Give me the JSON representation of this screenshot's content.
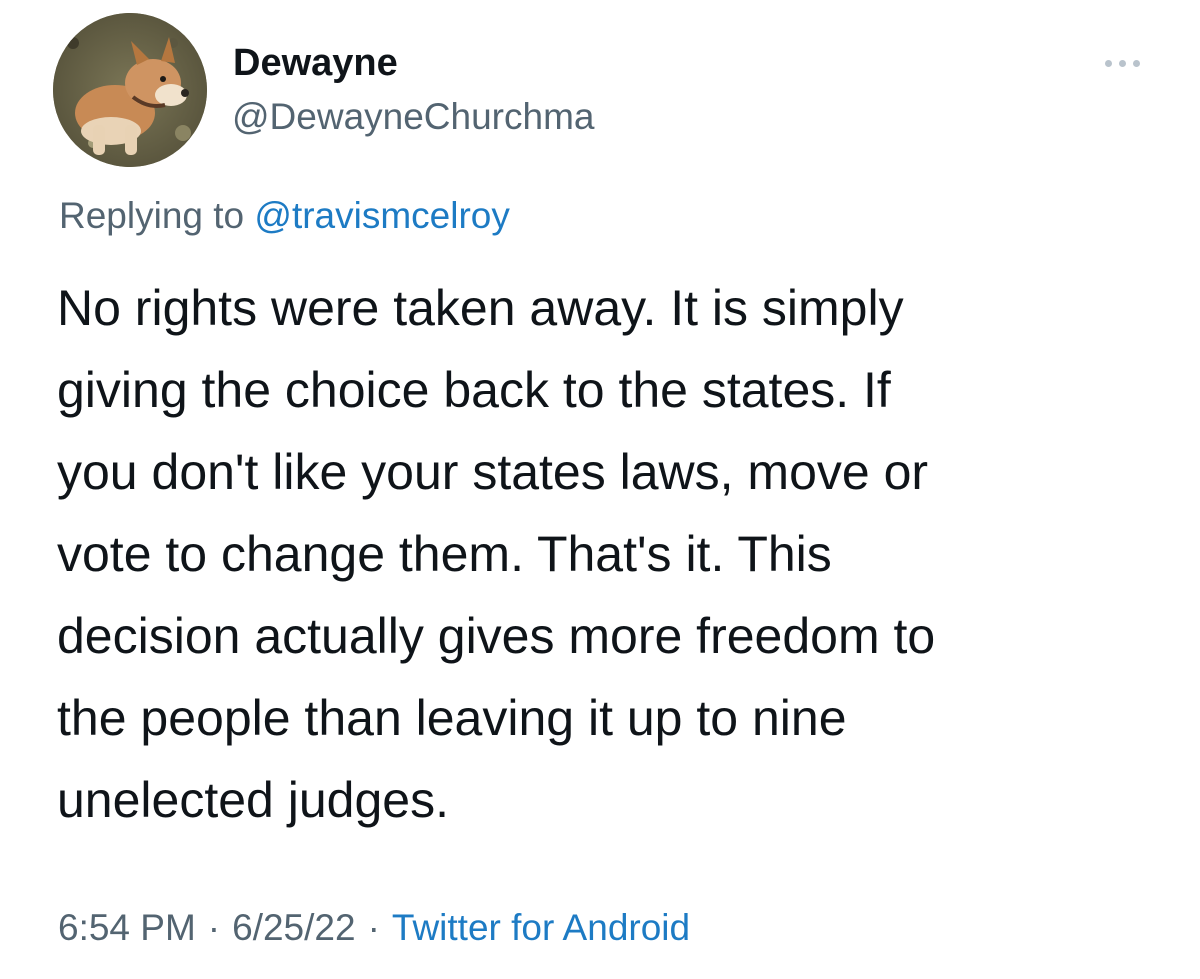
{
  "author": {
    "display_name": "Dewayne",
    "handle": "@DewayneChurchma",
    "avatar_icon": "dog-avatar"
  },
  "more_icon": "more-horizontal-icon",
  "reply": {
    "prefix": "Replying to ",
    "mention": "@travismcelroy"
  },
  "tweet_lines": [
    "No rights were taken away. It is simply",
    "giving the choice back to the states. If",
    "you don't like your states laws, move or",
    "vote to change them. That's it. This",
    "decision actually gives more freedom to",
    "the people than leaving it up to nine",
    "unelected judges."
  ],
  "meta": {
    "time": "6:54 PM",
    "separator": "·",
    "date": "6/25/22",
    "source": "Twitter for Android"
  },
  "colors": {
    "text": "#0f1419",
    "secondary": "#536471",
    "link": "#1d7bc4"
  }
}
